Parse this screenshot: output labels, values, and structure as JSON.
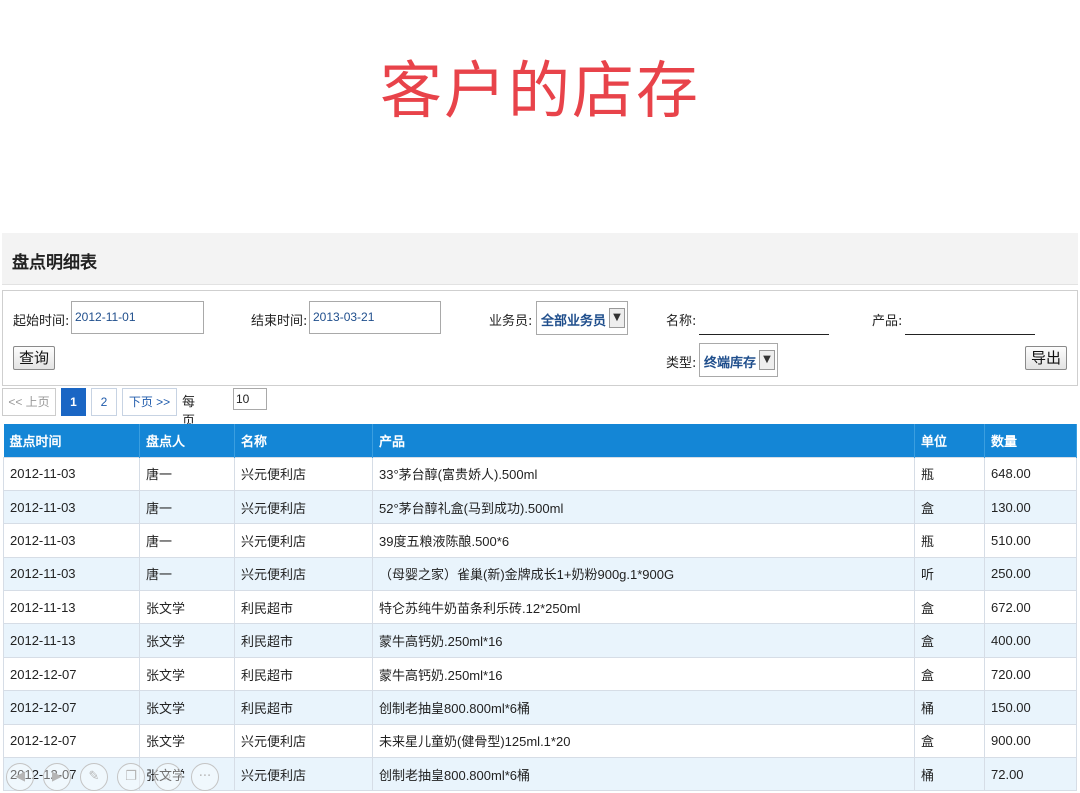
{
  "title": "客户的店存",
  "panel": {
    "header": "盘点明细表"
  },
  "filters": {
    "start_label": "起始时间:",
    "start_value": "2012-11-01",
    "end_label": "结束时间:",
    "end_value": "2013-03-21",
    "staff_label": "业务员:",
    "staff_value": "全部业务员",
    "name_label": "名称:",
    "product_label": "产品:",
    "type_label": "类型:",
    "type_value": "终端库存",
    "query_button": "查询",
    "export_button": "导出"
  },
  "pager": {
    "prev": "<< 上页",
    "pages": [
      "1",
      "2"
    ],
    "current": "1",
    "next": "下页 >>",
    "per_page_label": "每页显示",
    "per_page_value": "10"
  },
  "table": {
    "headers": [
      "盘点时间",
      "盘点人",
      "名称",
      "产品",
      "单位",
      "数量"
    ],
    "rows": [
      [
        "2012-11-03",
        "唐一",
        "兴元便利店",
        "33°茅台醇(富贵娇人).500ml",
        "瓶",
        "648.00"
      ],
      [
        "2012-11-03",
        "唐一",
        "兴元便利店",
        "52°茅台醇礼盒(马到成功).500ml",
        "盒",
        "130.00"
      ],
      [
        "2012-11-03",
        "唐一",
        "兴元便利店",
        "39度五粮液陈酿.500*6",
        "瓶",
        "510.00"
      ],
      [
        "2012-11-03",
        "唐一",
        "兴元便利店",
        "（母婴之家）雀巢(新)金牌成长1+奶粉900g.1*900G",
        "听",
        "250.00"
      ],
      [
        "2012-11-13",
        "张文学",
        "利民超市",
        "特仑苏纯牛奶苗条利乐砖.12*250ml",
        "盒",
        "672.00"
      ],
      [
        "2012-11-13",
        "张文学",
        "利民超市",
        "蒙牛高钙奶.250ml*16",
        "盒",
        "400.00"
      ],
      [
        "2012-12-07",
        "张文学",
        "利民超市",
        "蒙牛高钙奶.250ml*16",
        "盒",
        "720.00"
      ],
      [
        "2012-12-07",
        "张文学",
        "利民超市",
        "创制老抽皇800.800ml*6桶",
        "桶",
        "150.00"
      ],
      [
        "2012-12-07",
        "张文学",
        "兴元便利店",
        "未来星儿童奶(健骨型)125ml.1*20",
        "盒",
        "900.00"
      ],
      [
        "2012-12-07",
        "张文学",
        "兴元便利店",
        "创制老抽皇800.800ml*6桶",
        "桶",
        "72.00"
      ]
    ]
  },
  "toolbar_icons": [
    "prev-arrow-icon",
    "next-arrow-icon",
    "pen-icon",
    "copy-icon",
    "search-icon",
    "more-icon"
  ],
  "colors": {
    "title": "#e8434a",
    "table_header": "#1486d6",
    "row_alt": "#e9f4fc",
    "active_page": "#1a66c4"
  }
}
